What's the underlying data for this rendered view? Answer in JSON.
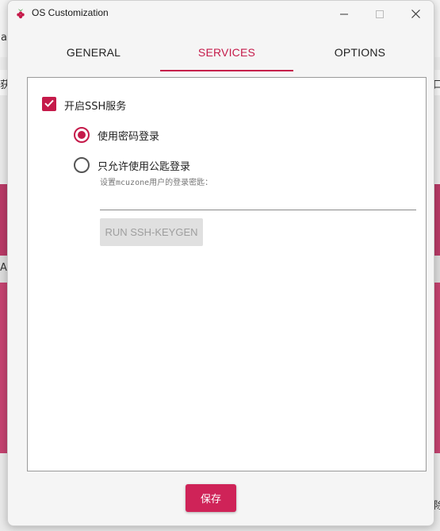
{
  "window": {
    "title": "OS Customization"
  },
  "tabs": [
    {
      "label": "GENERAL",
      "selected": false
    },
    {
      "label": "SERVICES",
      "selected": true
    },
    {
      "label": "OPTIONS",
      "selected": false
    }
  ],
  "services": {
    "ssh_enable": {
      "label": "开启SSH服务",
      "checked": true
    },
    "password_auth": {
      "label": "使用密码登录",
      "selected": true
    },
    "pubkey_auth": {
      "label": "只允许使用公匙登录",
      "selected": false
    },
    "pubkey_hint": "设置mcuzone用户的登录密匙：",
    "pubkey_value": "",
    "keygen_button_label": "RUN SSH-KEYGEN"
  },
  "footer": {
    "save_label": "保存"
  },
  "background_fragments": {
    "left_1": "a",
    "left_2": "获",
    "left_3": "A",
    "right_1": "口",
    "right_2": "除"
  },
  "colors": {
    "accent": "#c51a4a",
    "save_button": "#cf2358",
    "disabled_button": "#e0e0e0"
  }
}
